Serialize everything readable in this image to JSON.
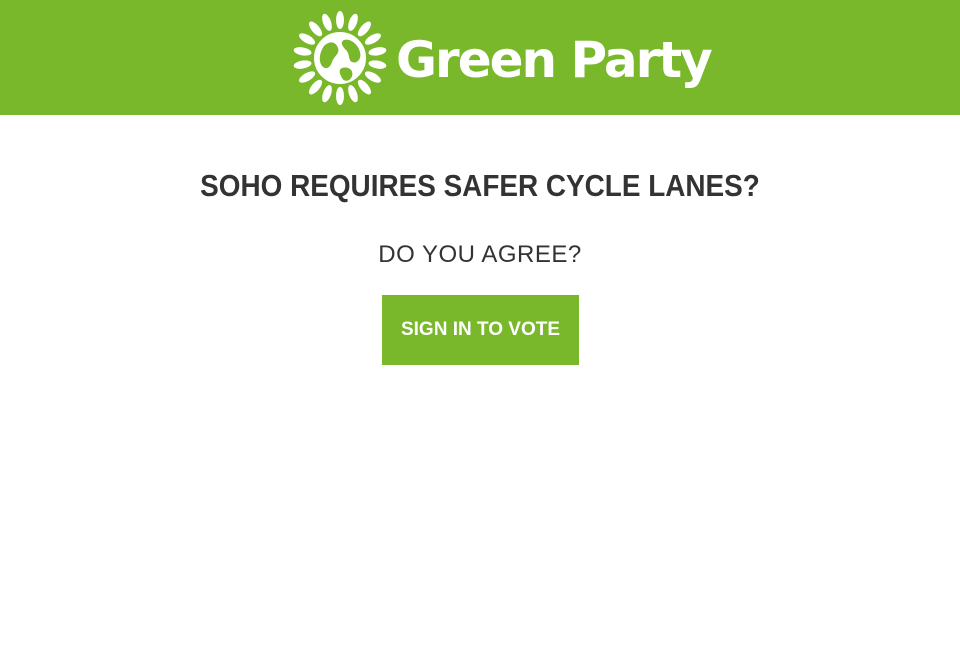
{
  "header": {
    "brand_name": "Green Party",
    "logo_icon": "sunflower-globe-icon",
    "background_color": "#78b82a"
  },
  "main": {
    "question": "SOHO REQUIRES SAFER CYCLE LANES?",
    "prompt": "DO YOU AGREE?",
    "vote_button_label": "SIGN IN TO VOTE",
    "button_color": "#78b82a",
    "text_color": "#333333"
  }
}
